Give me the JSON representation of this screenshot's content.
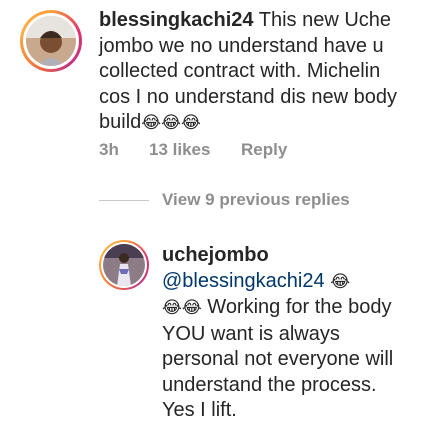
{
  "comment": {
    "username": "blessingkachi24",
    "text": "This new Uche jombo we no understand have u collected contract with. Michelin cos I no understand dis new body build",
    "emojis": "😂😂😂",
    "time": "3h",
    "likes": "13 likes",
    "reply_label": "Reply"
  },
  "view_replies": "View 9 previous replies",
  "reply": {
    "username": "uchejombo",
    "mention": "@blessingkachi24",
    "emoji_after_mention": "😂",
    "emoji_lead": "😂😂",
    "text": "Working for the body YOU want is always personal not everyone will understand the process. Yes I lift."
  }
}
